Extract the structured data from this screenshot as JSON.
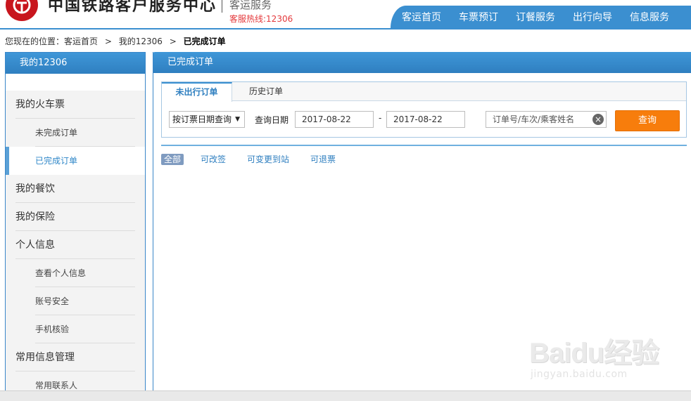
{
  "header": {
    "site_title": "中国铁路客户服务中心",
    "subtitle": "客运服务",
    "hotline": "客服热线:12306",
    "nav": [
      {
        "label": "客运首页"
      },
      {
        "label": "车票预订"
      },
      {
        "label": "订餐服务"
      },
      {
        "label": "出行向导"
      },
      {
        "label": "信息服务"
      }
    ]
  },
  "breadcrumb": {
    "prefix": "您现在的位置：客运首页",
    "sep1": ">",
    "middle": "我的12306",
    "sep2": ">",
    "current": "已完成订单"
  },
  "sidebar": {
    "title": "我的12306",
    "items": [
      {
        "label": "我的火车票",
        "level": 1
      },
      {
        "label": "未完成订单",
        "level": 2
      },
      {
        "label": "已完成订单",
        "level": 2,
        "active": true
      },
      {
        "label": "我的餐饮",
        "level": 1
      },
      {
        "label": "我的保险",
        "level": 1
      },
      {
        "label": "个人信息",
        "level": 1
      },
      {
        "label": "查看个人信息",
        "level": 2
      },
      {
        "label": "账号安全",
        "level": 2
      },
      {
        "label": "手机核验",
        "level": 2
      },
      {
        "label": "常用信息管理",
        "level": 1
      },
      {
        "label": "常用联系人",
        "level": 2
      }
    ]
  },
  "main": {
    "title": "已完成订单",
    "tabs": [
      {
        "label": "未出行订单",
        "active": true
      },
      {
        "label": "历史订单",
        "active": false
      }
    ],
    "query": {
      "filter_select_value": "按订票日期查询",
      "date_label": "查询日期",
      "date_start": "2017-08-22",
      "date_separator": "-",
      "date_end": "2017-08-22",
      "order_search_placeholder": "订单号/车次/乘客姓名",
      "query_button": "查询"
    },
    "filters": [
      {
        "label": "全部",
        "selected": true
      },
      {
        "label": "可改签",
        "selected": false
      },
      {
        "label": "可变更到站",
        "selected": false
      },
      {
        "label": "可退票",
        "selected": false
      }
    ]
  },
  "watermark": {
    "logo": "Baidu经验",
    "url": "jingyan.baidu.com"
  },
  "colors": {
    "brand_blue": "#3b8fd0",
    "action_orange": "#f77d0c",
    "logo_red": "#c8151d",
    "hotline_red": "#e4393c"
  }
}
